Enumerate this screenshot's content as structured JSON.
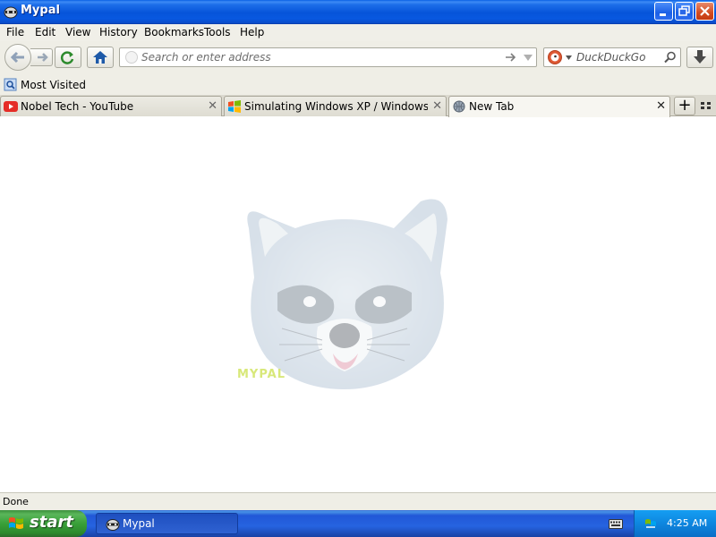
{
  "window": {
    "title": "Mypal"
  },
  "menu": [
    "File",
    "Edit",
    "View",
    "History",
    "Bookmarks",
    "Tools",
    "Help"
  ],
  "address_bar": {
    "placeholder": "Search or enter address"
  },
  "search_bar": {
    "placeholder": "DuckDuckGo"
  },
  "bookmarks": {
    "most_visited": "Most Visited"
  },
  "tabs": [
    {
      "label": "Nobel Tech - YouTube",
      "icon": "youtube-icon"
    },
    {
      "label": "Simulating Windows XP / Windows Vista /...",
      "icon": "windows-icon"
    },
    {
      "label": "New Tab",
      "icon": "globe-icon",
      "active": true
    }
  ],
  "content": {
    "logo_text": "MYPAL"
  },
  "status": "Done",
  "taskbar": {
    "start_label": "start",
    "task_label": "Mypal",
    "clock": "4:25 AM"
  },
  "colors": {
    "xp_blue": "#0654da",
    "start_green": "#39a039",
    "tray_blue": "#0e86df"
  }
}
